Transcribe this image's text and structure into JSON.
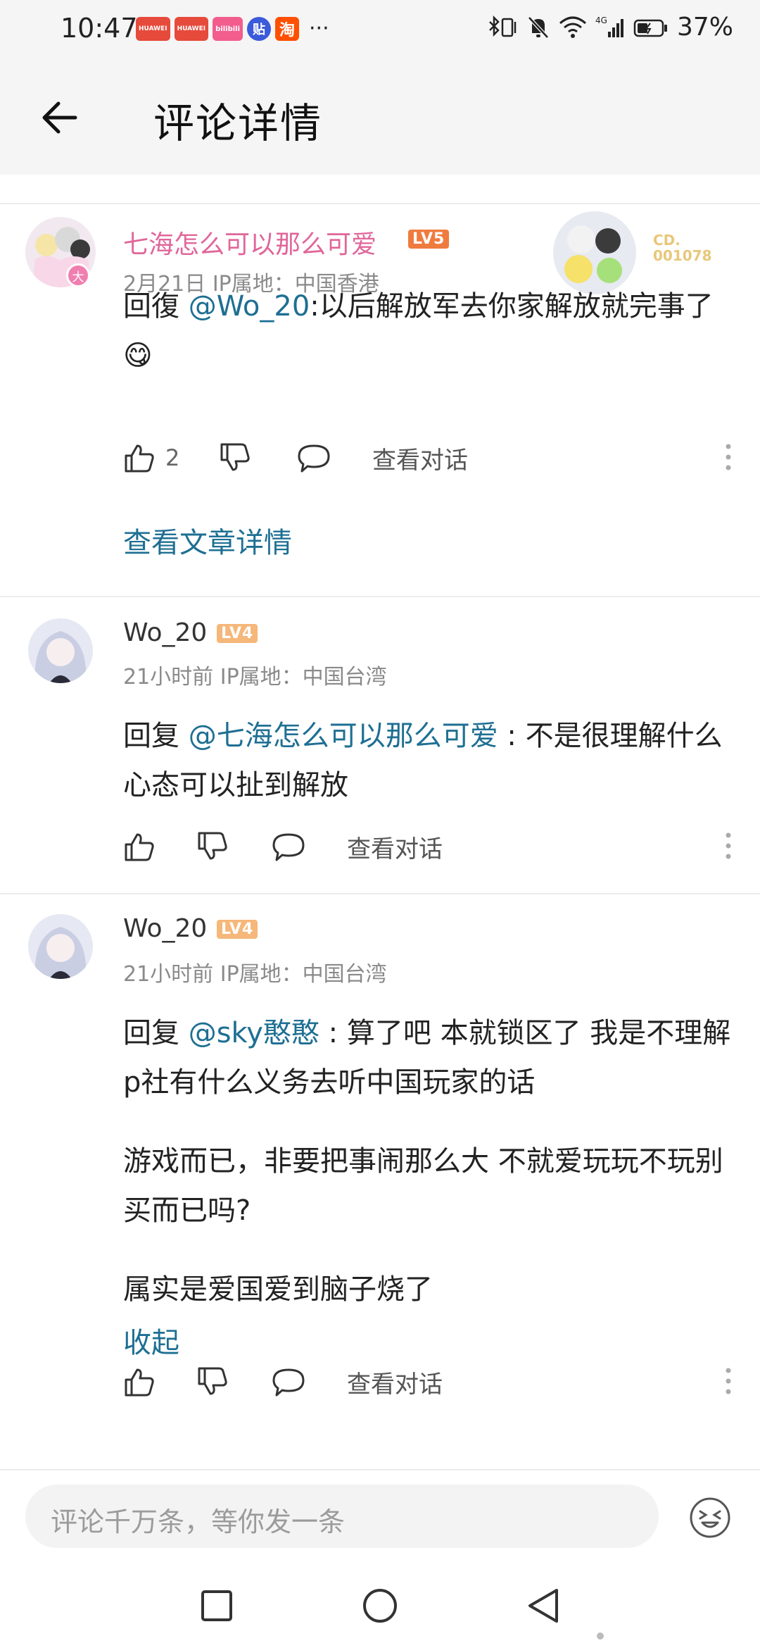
{
  "status_bar": {
    "time": "10:47",
    "apps": [
      {
        "label": "HUAWEI",
        "color": "#e64a3b"
      },
      {
        "label": "HUAWEI",
        "color": "#e64a3b"
      },
      {
        "label": "bilibili",
        "color": "#f25d8e"
      },
      {
        "label": "贴",
        "color": "#3b5bdb"
      },
      {
        "label": "淘",
        "color": "#ff5000"
      }
    ],
    "more": "···",
    "network": "4G",
    "battery": "37%"
  },
  "header": {
    "title": "评论详情",
    "back_icon": "back-arrow-icon"
  },
  "comments": [
    {
      "username": "七海怎么可以那么可爱",
      "username_color": "#e0669a",
      "level": "LV5",
      "level_color": "#f07b3f",
      "date": "2月21日",
      "ip": "IP属地：中国香港",
      "badge_text": "大",
      "card_no": "CD.\n001078",
      "reply_prefix": "回復",
      "mention": "@Wo_20",
      "text": ":以后解放军去你家解放就完事了",
      "emoji": "😋",
      "likes": "2",
      "view_dialog": "查看对话",
      "article_link": "查看文章详情"
    },
    {
      "username": "Wo_20",
      "username_color": "#333333",
      "level": "LV4",
      "level_color": "#f5b77a",
      "date": "21小时前",
      "ip": "IP属地：中国台湾",
      "reply_prefix": "回复",
      "mention": "@七海怎么可以那么可爱",
      "text": " : 不是很理解什么心态可以扯到解放",
      "view_dialog": "查看对话"
    },
    {
      "username": "Wo_20",
      "username_color": "#333333",
      "level": "LV4",
      "level_color": "#f5b77a",
      "date": "21小时前",
      "ip": "IP属地：中国台湾",
      "reply_prefix": "回复",
      "mention": "@sky憨憨",
      "text_line1": " : 算了吧 本就锁区了 我是不理解p社有什么义务去听中国玩家的话",
      "text_line2": "游戏而已，非要把事闹那么大 不就爱玩玩不玩别买而已吗?",
      "text_line3": "属实是爱国爱到脑子烧了",
      "collapse": "收起",
      "view_dialog": "查看对话"
    }
  ],
  "input": {
    "placeholder": "评论千万条，等你发一条"
  },
  "colors": {
    "accent": "#1e6f93",
    "bg_header": "#f5f5f5"
  }
}
